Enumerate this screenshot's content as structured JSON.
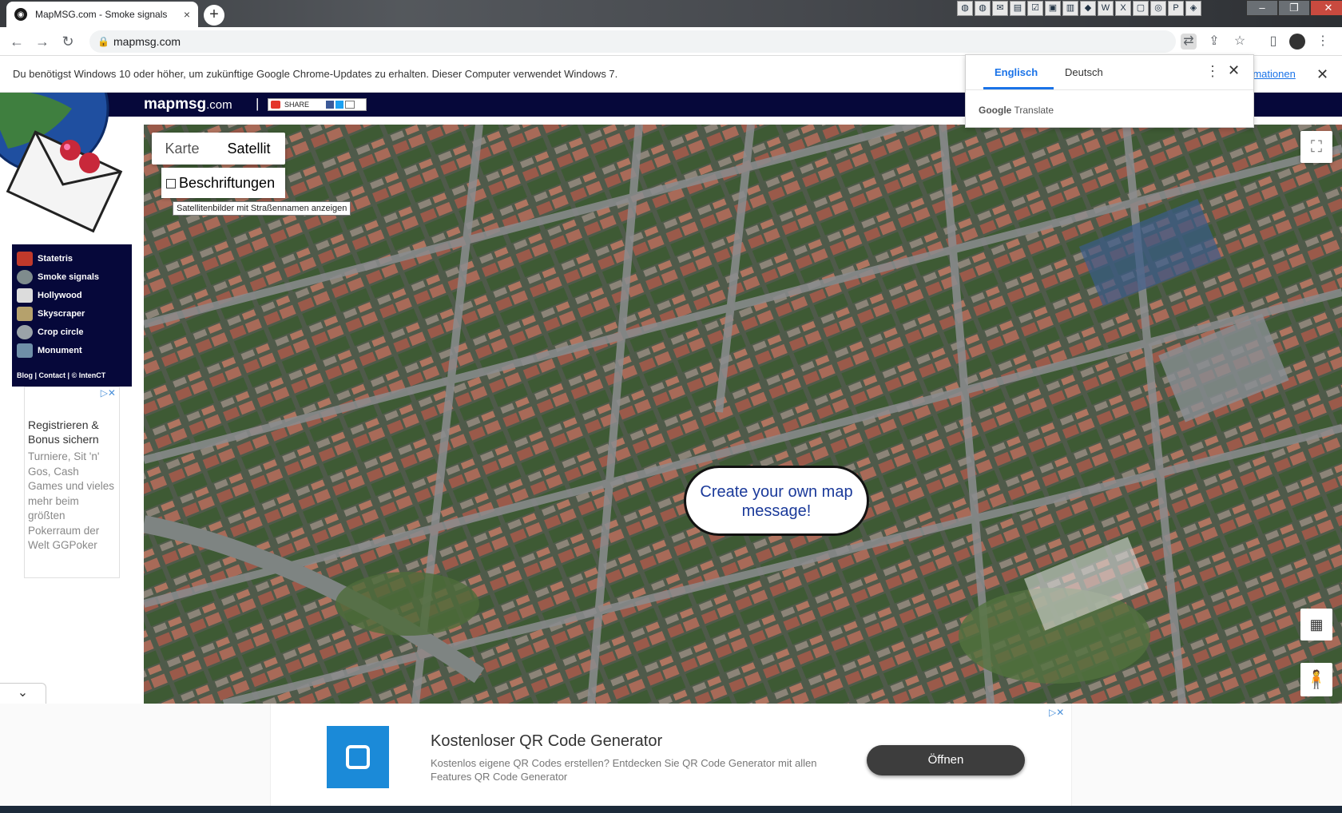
{
  "browser": {
    "tab_title": "MapMSG.com - Smoke signals",
    "tab_close": "×",
    "new_tab": "+",
    "url": "mapmsg.com",
    "lock": "🔒"
  },
  "infobar": {
    "message": "Du benötigst Windows 10 oder höher, um zukünftige Google Chrome-Updates zu erhalten. Dieser Computer verwendet Windows 7.",
    "more_link": "rmationen",
    "close": "✕"
  },
  "translate": {
    "lang_source": "Englisch",
    "lang_target": "Deutsch",
    "brand_google": "Google",
    "brand_translate": "Translate",
    "menu": "⋮",
    "close": "✕"
  },
  "site": {
    "name": "mapmsg",
    "tld": ".com",
    "separator": "|",
    "share_label": "SHARE"
  },
  "menu": {
    "items": [
      {
        "label": "Statetris",
        "color": "#c0392b"
      },
      {
        "label": "Smoke signals",
        "color": "#7f8c8d"
      },
      {
        "label": "Hollywood",
        "color": "#dcdcdc"
      },
      {
        "label": "Skyscraper",
        "color": "#b5a16c"
      },
      {
        "label": "Crop circle",
        "color": "#9aa3a8"
      },
      {
        "label": "Monument",
        "color": "#6f8fa8"
      }
    ],
    "links": {
      "blog": "Blog",
      "contact": "Contact",
      "copyright": "© IntenCT"
    }
  },
  "ad_left": {
    "headline": "Registrieren & Bonus sichern",
    "body": "Turniere, Sit 'n' Gos, Cash Games und vieles mehr beim größten Pokerraum der Welt GGPoker",
    "choices": "▷✕"
  },
  "map": {
    "type_map": "Karte",
    "type_satellite": "Satellit",
    "labels_checkbox": "Beschriftungen",
    "tooltip": "Satellitenbilder mit Straßennamen anzeigen",
    "bubble_text": "Create your own map message!",
    "fullscreen_icon": "⛶",
    "tilt_icon": "▦",
    "pegman_icon": "🧍"
  },
  "ad_bottom": {
    "title": "Kostenloser QR Code Generator",
    "text": "Kostenlos eigene QR Codes erstellen? Entdecken Sie QR Code Generator mit allen Features QR Code Generator",
    "button": "Öffnen",
    "choices": "▷✕"
  },
  "collapse_icon": "⌄"
}
